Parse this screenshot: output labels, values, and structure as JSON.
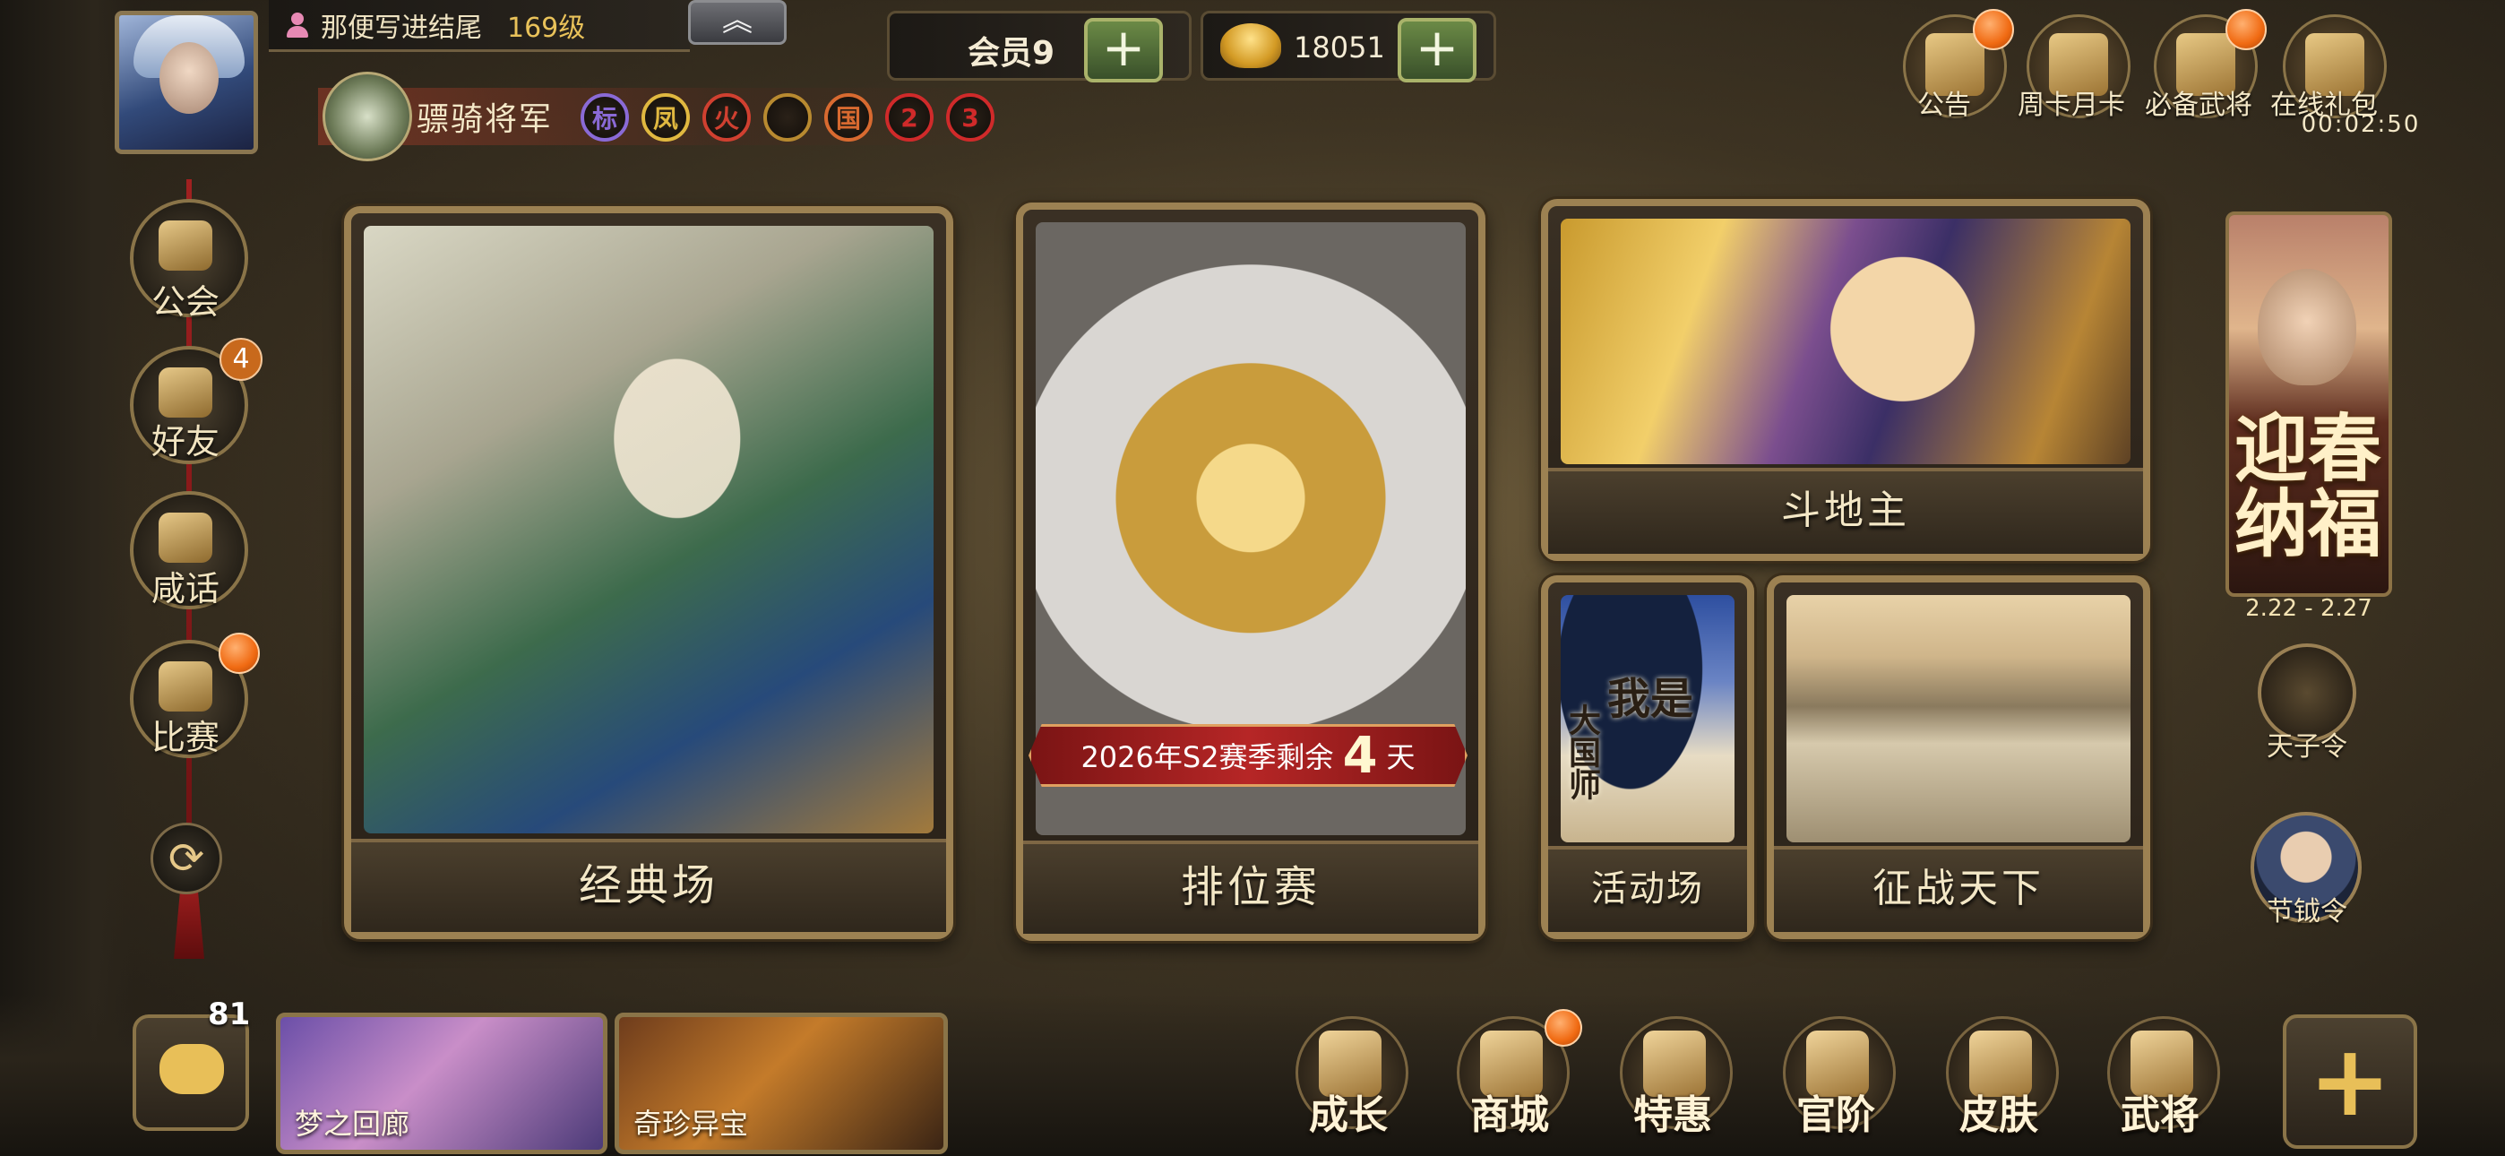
{
  "player": {
    "name": "那便写进结尾",
    "level": "169级",
    "rank_title": "骠骑将军",
    "badges": [
      {
        "text": "标",
        "color": "#8a6ad6"
      },
      {
        "text": "凤",
        "color": "#e0b840"
      },
      {
        "text": "火",
        "color": "#d04030"
      },
      {
        "text": "",
        "color": "#b88a30"
      },
      {
        "text": "国",
        "color": "#d86a30"
      },
      {
        "text": "2",
        "color": "#d02a2a"
      },
      {
        "text": "3",
        "color": "#d02a2a"
      }
    ]
  },
  "currency": {
    "vip_label": "会员9",
    "gold": "18051"
  },
  "top_icons": [
    {
      "label": "公告",
      "icon": "announcement-icon",
      "has_dot": true
    },
    {
      "label": "周卡月卡",
      "icon": "card-icon",
      "has_dot": false
    },
    {
      "label": "必备武将",
      "icon": "fist-icon",
      "has_dot": true
    },
    {
      "label": "在线礼包",
      "icon": "gift-icon",
      "has_dot": false
    }
  ],
  "gift_timer": "00:02:50",
  "side_menu": [
    {
      "label": "公会",
      "icon": "guild-icon"
    },
    {
      "label": "好友",
      "icon": "friends-icon",
      "count": "4"
    },
    {
      "label": "咸话",
      "icon": "emoji-icon"
    },
    {
      "label": "比赛",
      "icon": "swords-icon",
      "has_dot": true
    }
  ],
  "modes": {
    "classic": "经典场",
    "ranked": "排位赛",
    "ranked_banner_prefix": "2026年S2赛季剩余",
    "ranked_days": "4",
    "ranked_banner_suffix": "天",
    "landlord": "斗地主",
    "event": "活动场",
    "event_caption": "我是",
    "event_caption_sub": "大国师",
    "conquest": "征战天下"
  },
  "festival": {
    "title": "迎春纳福",
    "dates": "2.22 - 2.27"
  },
  "right_menu": {
    "tianzi": "天子令",
    "jieyue": "节钺令"
  },
  "chat": {
    "count": "81"
  },
  "promos": [
    {
      "label": "梦之回廊"
    },
    {
      "label": "奇珍异宝"
    }
  ],
  "bottom_nav": [
    {
      "label": "成长",
      "icon": "growth-icon"
    },
    {
      "label": "商城",
      "icon": "shop-icon",
      "has_dot": true
    },
    {
      "label": "特惠",
      "icon": "sale-icon"
    },
    {
      "label": "官阶",
      "icon": "rank-icon"
    },
    {
      "label": "皮肤",
      "icon": "skin-icon"
    },
    {
      "label": "武将",
      "icon": "general-icon"
    }
  ],
  "colors": {
    "accent_gold": "#e9c25a",
    "notification": "#f06a12",
    "frame": "#9c8152"
  }
}
